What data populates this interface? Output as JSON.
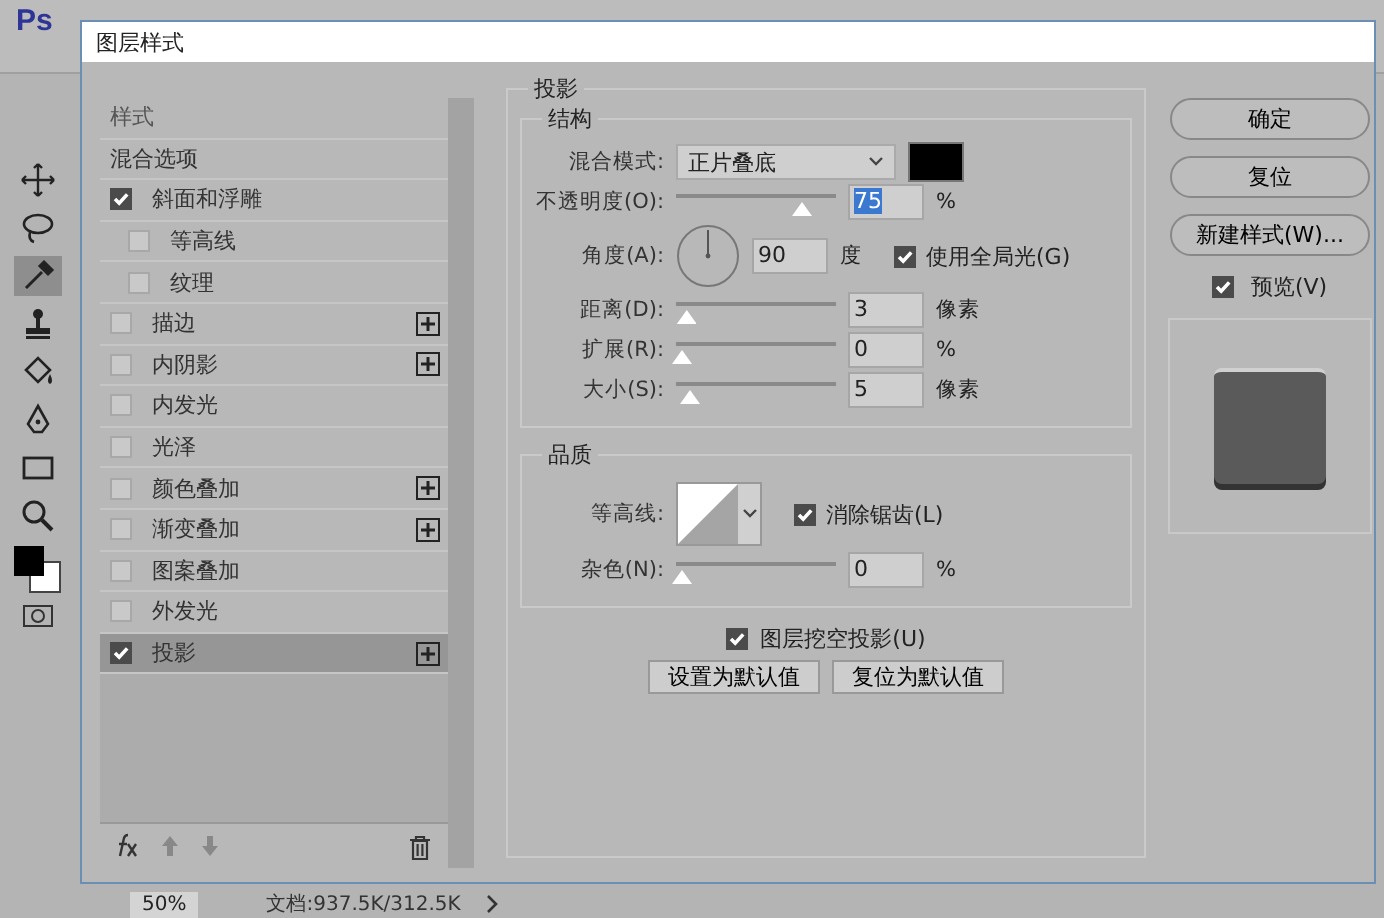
{
  "app": {
    "logo": "Ps",
    "zoom": "50%",
    "doc_info": "文档:937.5K/312.5K"
  },
  "dialog": {
    "title": "图层样式"
  },
  "styles": {
    "header": "样式",
    "items": [
      {
        "label": "混合选项",
        "kind": "plain",
        "selected": false
      },
      {
        "label": "斜面和浮雕",
        "kind": "check",
        "checked": true,
        "selected": false,
        "addable": false,
        "children": [
          {
            "label": "等高线",
            "kind": "check",
            "checked": false,
            "selected": false,
            "addable": false
          },
          {
            "label": "纹理",
            "kind": "check",
            "checked": false,
            "selected": false,
            "addable": false
          }
        ]
      },
      {
        "label": "描边",
        "kind": "check",
        "checked": false,
        "selected": false,
        "addable": true
      },
      {
        "label": "内阴影",
        "kind": "check",
        "checked": false,
        "selected": false,
        "addable": true
      },
      {
        "label": "内发光",
        "kind": "check",
        "checked": false,
        "selected": false,
        "addable": false
      },
      {
        "label": "光泽",
        "kind": "check",
        "checked": false,
        "selected": false,
        "addable": false
      },
      {
        "label": "颜色叠加",
        "kind": "check",
        "checked": false,
        "selected": false,
        "addable": true
      },
      {
        "label": "渐变叠加",
        "kind": "check",
        "checked": false,
        "selected": false,
        "addable": true
      },
      {
        "label": "图案叠加",
        "kind": "check",
        "checked": false,
        "selected": false,
        "addable": false
      },
      {
        "label": "外发光",
        "kind": "check",
        "checked": false,
        "selected": false,
        "addable": false
      },
      {
        "label": "投影",
        "kind": "check",
        "checked": true,
        "selected": true,
        "addable": true
      }
    ]
  },
  "shadow": {
    "title": "投影",
    "structure": {
      "title": "结构",
      "rows": [
        {
          "kind": "select",
          "label": "混合模式:",
          "value": "正片叠底"
        },
        {
          "kind": "slider",
          "label": "不透明度(O):",
          "level": 0.75,
          "value": "75",
          "unit": "%",
          "text_selected": true
        },
        {
          "kind": "angle",
          "label": "角度(A):",
          "value": "90",
          "unit": "度",
          "option": {
            "label": "使用全局光(G)",
            "checked": true
          }
        },
        {
          "kind": "slider",
          "label": "距离(D):",
          "level": 0.03,
          "value": "3",
          "unit": "像素",
          "text_selected": false
        },
        {
          "kind": "slider",
          "label": "扩展(R):",
          "level": 0,
          "value": "0",
          "unit": "%",
          "text_selected": false
        },
        {
          "kind": "slider",
          "label": "大小(S):",
          "level": 0.05,
          "value": "5",
          "unit": "像素",
          "text_selected": false
        }
      ]
    },
    "quality": {
      "title": "品质",
      "rows": [
        {
          "kind": "contour",
          "label": "等高线:",
          "option": {
            "label": "消除锯齿(L)",
            "checked": true
          }
        },
        {
          "kind": "slider",
          "label": "杂色(N):",
          "level": 0,
          "value": "0",
          "unit": "%",
          "text_selected": false
        }
      ]
    },
    "knockout": {
      "label": "图层挖空投影(U)",
      "checked": true
    },
    "buttons": [
      "设置为默认值",
      "复位为默认值"
    ]
  },
  "actions": {
    "buttons": [
      "确定",
      "复位",
      "新建样式(W)..."
    ],
    "preview": {
      "label": "预览(V)",
      "checked": true
    }
  }
}
